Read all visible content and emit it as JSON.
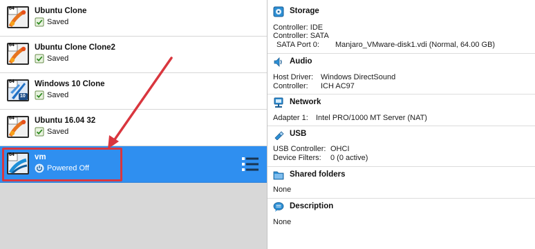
{
  "vms": [
    {
      "name": "Ubuntu Clone",
      "state": "Saved",
      "os_badge": "64",
      "os_icon": "ubuntu-icon"
    },
    {
      "name": "Ubuntu Clone Clone2",
      "state": "Saved",
      "os_badge": "64",
      "os_icon": "ubuntu-icon"
    },
    {
      "name": "Windows 10 Clone",
      "state": "Saved",
      "os_badge": "64",
      "os_extra_badge": "10",
      "os_icon": "windows-10-icon"
    },
    {
      "name": "Ubuntu 16.04 32",
      "state": "Saved",
      "os_badge": "64",
      "os_icon": "ubuntu-icon"
    },
    {
      "name": "vm",
      "state": "Powered Off",
      "os_badge": "64",
      "os_icon": "arch-icon",
      "selected": true
    }
  ],
  "details": {
    "storage": {
      "title": "Storage",
      "controller_ide": "Controller: IDE",
      "controller_sata": "Controller: SATA",
      "sata_port_label": "SATA Port 0:",
      "sata_port_value": "Manjaro_VMware-disk1.vdi (Normal, 64.00 GB)"
    },
    "audio": {
      "title": "Audio",
      "host_driver_label": "Host Driver:",
      "host_driver_value": "Windows DirectSound",
      "controller_label": "Controller:",
      "controller_value": "ICH AC97"
    },
    "network": {
      "title": "Network",
      "adapter_label": "Adapter 1:",
      "adapter_value": "Intel PRO/1000 MT Server (NAT)"
    },
    "usb": {
      "title": "USB",
      "controller_label": "USB Controller:",
      "controller_value": "OHCI",
      "filters_label": "Device Filters:",
      "filters_value": "0 (0 active)"
    },
    "shared_folders": {
      "title": "Shared folders",
      "value": "None"
    },
    "description": {
      "title": "Description",
      "value": "None"
    }
  },
  "colors": {
    "selection": "#2f8ff0",
    "annotation": "#d9363e"
  }
}
